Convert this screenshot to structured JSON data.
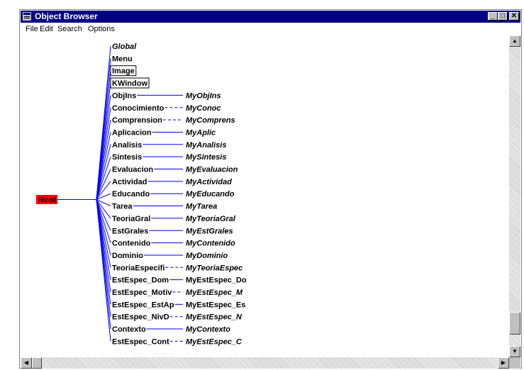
{
  "window": {
    "title": "Object Browser",
    "title_color": "#000080"
  },
  "menu": [
    "File",
    "Edit",
    "Search",
    "Options"
  ],
  "tree": {
    "root": "Root",
    "root_color": "#ff0000",
    "line_color": "#0000ff",
    "nodes": [
      {
        "label": "Global",
        "italic": true,
        "boxed": false,
        "link": ""
      },
      {
        "label": "Menu",
        "italic": false,
        "boxed": false,
        "link": ""
      },
      {
        "label": "Image",
        "italic": false,
        "boxed": true,
        "link": ""
      },
      {
        "label": "KWindow",
        "italic": false,
        "boxed": true,
        "link": ""
      },
      {
        "label": "ObjIns",
        "italic": false,
        "boxed": false,
        "link": "solid",
        "child": "MyObjIns",
        "child_italic": true
      },
      {
        "label": "Conocimiento",
        "italic": false,
        "boxed": false,
        "link": "dashed",
        "child": "MyConoc",
        "child_italic": true
      },
      {
        "label": "Comprension",
        "italic": false,
        "boxed": false,
        "link": "dashed",
        "child": "MyComprens",
        "child_italic": true
      },
      {
        "label": "Aplicacion",
        "italic": false,
        "boxed": false,
        "link": "solid",
        "child": "MyAplic",
        "child_italic": true
      },
      {
        "label": "Analisis",
        "italic": false,
        "boxed": false,
        "link": "solid",
        "child": "MyAnalisis",
        "child_italic": true
      },
      {
        "label": "Sintesis",
        "italic": false,
        "boxed": false,
        "link": "solid",
        "child": "MySintesis",
        "child_italic": true
      },
      {
        "label": "Evaluacion",
        "italic": false,
        "boxed": false,
        "link": "solid",
        "child": "MyEvaluacion",
        "child_italic": true
      },
      {
        "label": "Actividad",
        "italic": false,
        "boxed": false,
        "link": "solid",
        "child": "MyActividad",
        "child_italic": true
      },
      {
        "label": "Educando",
        "italic": false,
        "boxed": false,
        "link": "solid",
        "child": "MyEducando",
        "child_italic": true
      },
      {
        "label": "Tarea",
        "italic": false,
        "boxed": false,
        "link": "solid",
        "child": "MyTarea",
        "child_italic": true
      },
      {
        "label": "TeoriaGral",
        "italic": false,
        "boxed": false,
        "link": "solid",
        "child": "MyTeoriaGral",
        "child_italic": true
      },
      {
        "label": "EstGrales",
        "italic": false,
        "boxed": false,
        "link": "solid",
        "child": "MyEstGrales",
        "child_italic": true
      },
      {
        "label": "Contenido",
        "italic": false,
        "boxed": false,
        "link": "solid",
        "child": "MyContenido",
        "child_italic": true
      },
      {
        "label": "Dominio",
        "italic": false,
        "boxed": false,
        "link": "solid",
        "child": "MyDominio",
        "child_italic": true
      },
      {
        "label": "TeoriaEspecifi",
        "italic": false,
        "boxed": false,
        "link": "dashed",
        "child": "MyTeoriaEspec",
        "child_italic": true
      },
      {
        "label": "EstEspec_Dom",
        "italic": false,
        "boxed": false,
        "link": "solid",
        "child": "MyEstEspec_Do",
        "child_italic": false
      },
      {
        "label": "EstEspec_Motiv",
        "italic": false,
        "boxed": false,
        "link": "dashed",
        "child": "MyEstEspec_M",
        "child_italic": true
      },
      {
        "label": "EstEspec_EstAp",
        "italic": false,
        "boxed": false,
        "link": "solid",
        "child": "MyEstEspec_Es",
        "child_italic": false
      },
      {
        "label": "EstEspec_NivD",
        "italic": false,
        "boxed": false,
        "link": "dashed",
        "child": "MyEstEspec_N",
        "child_italic": true
      },
      {
        "label": "Contexto",
        "italic": false,
        "boxed": false,
        "link": "solid",
        "child": "MyContexto",
        "child_italic": true
      },
      {
        "label": "EstEspec_Cont",
        "italic": false,
        "boxed": false,
        "link": "dashed",
        "child": "MyEstEspec_C",
        "child_italic": true
      }
    ]
  }
}
